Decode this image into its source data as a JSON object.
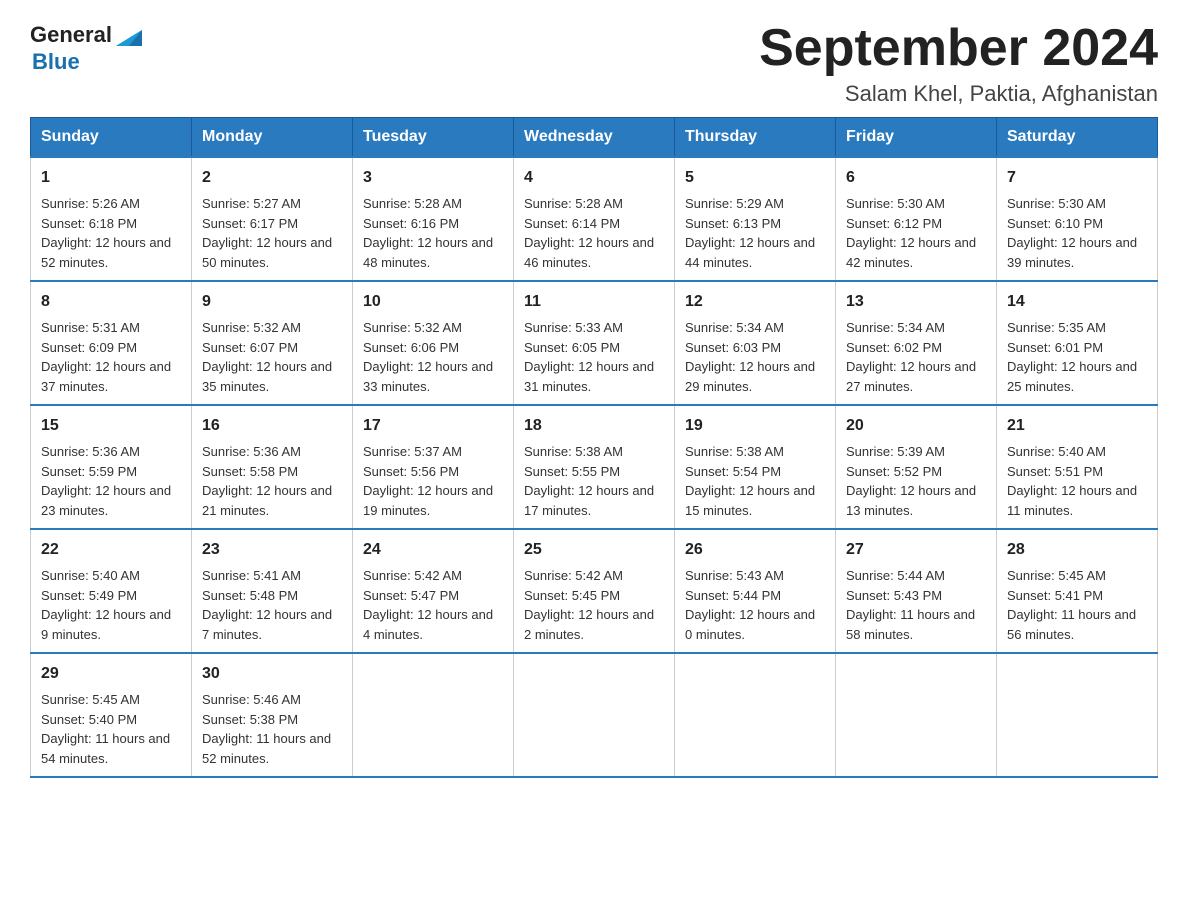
{
  "header": {
    "logo_general": "General",
    "logo_blue": "Blue",
    "title": "September 2024",
    "subtitle": "Salam Khel, Paktia, Afghanistan"
  },
  "weekdays": [
    "Sunday",
    "Monday",
    "Tuesday",
    "Wednesday",
    "Thursday",
    "Friday",
    "Saturday"
  ],
  "weeks": [
    [
      {
        "day": "1",
        "sunrise": "5:26 AM",
        "sunset": "6:18 PM",
        "daylight": "12 hours and 52 minutes."
      },
      {
        "day": "2",
        "sunrise": "5:27 AM",
        "sunset": "6:17 PM",
        "daylight": "12 hours and 50 minutes."
      },
      {
        "day": "3",
        "sunrise": "5:28 AM",
        "sunset": "6:16 PM",
        "daylight": "12 hours and 48 minutes."
      },
      {
        "day": "4",
        "sunrise": "5:28 AM",
        "sunset": "6:14 PM",
        "daylight": "12 hours and 46 minutes."
      },
      {
        "day": "5",
        "sunrise": "5:29 AM",
        "sunset": "6:13 PM",
        "daylight": "12 hours and 44 minutes."
      },
      {
        "day": "6",
        "sunrise": "5:30 AM",
        "sunset": "6:12 PM",
        "daylight": "12 hours and 42 minutes."
      },
      {
        "day": "7",
        "sunrise": "5:30 AM",
        "sunset": "6:10 PM",
        "daylight": "12 hours and 39 minutes."
      }
    ],
    [
      {
        "day": "8",
        "sunrise": "5:31 AM",
        "sunset": "6:09 PM",
        "daylight": "12 hours and 37 minutes."
      },
      {
        "day": "9",
        "sunrise": "5:32 AM",
        "sunset": "6:07 PM",
        "daylight": "12 hours and 35 minutes."
      },
      {
        "day": "10",
        "sunrise": "5:32 AM",
        "sunset": "6:06 PM",
        "daylight": "12 hours and 33 minutes."
      },
      {
        "day": "11",
        "sunrise": "5:33 AM",
        "sunset": "6:05 PM",
        "daylight": "12 hours and 31 minutes."
      },
      {
        "day": "12",
        "sunrise": "5:34 AM",
        "sunset": "6:03 PM",
        "daylight": "12 hours and 29 minutes."
      },
      {
        "day": "13",
        "sunrise": "5:34 AM",
        "sunset": "6:02 PM",
        "daylight": "12 hours and 27 minutes."
      },
      {
        "day": "14",
        "sunrise": "5:35 AM",
        "sunset": "6:01 PM",
        "daylight": "12 hours and 25 minutes."
      }
    ],
    [
      {
        "day": "15",
        "sunrise": "5:36 AM",
        "sunset": "5:59 PM",
        "daylight": "12 hours and 23 minutes."
      },
      {
        "day": "16",
        "sunrise": "5:36 AM",
        "sunset": "5:58 PM",
        "daylight": "12 hours and 21 minutes."
      },
      {
        "day": "17",
        "sunrise": "5:37 AM",
        "sunset": "5:56 PM",
        "daylight": "12 hours and 19 minutes."
      },
      {
        "day": "18",
        "sunrise": "5:38 AM",
        "sunset": "5:55 PM",
        "daylight": "12 hours and 17 minutes."
      },
      {
        "day": "19",
        "sunrise": "5:38 AM",
        "sunset": "5:54 PM",
        "daylight": "12 hours and 15 minutes."
      },
      {
        "day": "20",
        "sunrise": "5:39 AM",
        "sunset": "5:52 PM",
        "daylight": "12 hours and 13 minutes."
      },
      {
        "day": "21",
        "sunrise": "5:40 AM",
        "sunset": "5:51 PM",
        "daylight": "12 hours and 11 minutes."
      }
    ],
    [
      {
        "day": "22",
        "sunrise": "5:40 AM",
        "sunset": "5:49 PM",
        "daylight": "12 hours and 9 minutes."
      },
      {
        "day": "23",
        "sunrise": "5:41 AM",
        "sunset": "5:48 PM",
        "daylight": "12 hours and 7 minutes."
      },
      {
        "day": "24",
        "sunrise": "5:42 AM",
        "sunset": "5:47 PM",
        "daylight": "12 hours and 4 minutes."
      },
      {
        "day": "25",
        "sunrise": "5:42 AM",
        "sunset": "5:45 PM",
        "daylight": "12 hours and 2 minutes."
      },
      {
        "day": "26",
        "sunrise": "5:43 AM",
        "sunset": "5:44 PM",
        "daylight": "12 hours and 0 minutes."
      },
      {
        "day": "27",
        "sunrise": "5:44 AM",
        "sunset": "5:43 PM",
        "daylight": "11 hours and 58 minutes."
      },
      {
        "day": "28",
        "sunrise": "5:45 AM",
        "sunset": "5:41 PM",
        "daylight": "11 hours and 56 minutes."
      }
    ],
    [
      {
        "day": "29",
        "sunrise": "5:45 AM",
        "sunset": "5:40 PM",
        "daylight": "11 hours and 54 minutes."
      },
      {
        "day": "30",
        "sunrise": "5:46 AM",
        "sunset": "5:38 PM",
        "daylight": "11 hours and 52 minutes."
      },
      null,
      null,
      null,
      null,
      null
    ]
  ]
}
